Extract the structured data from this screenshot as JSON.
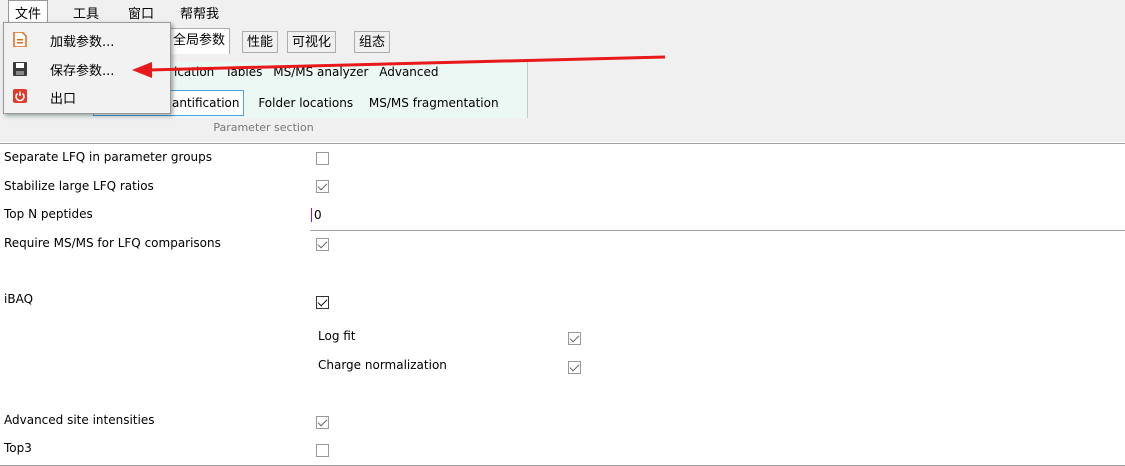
{
  "menubar": {
    "items": [
      "文件",
      "工具",
      "窗口",
      "帮帮我"
    ]
  },
  "file_menu": {
    "items": [
      "加载参数...",
      "保存参数...",
      "出口"
    ]
  },
  "tabs": [
    "全局参数",
    "性能",
    "可视化",
    "组态"
  ],
  "ribbon": {
    "row1": [
      "ication",
      "Tables",
      "MS/MS analyzer",
      "Advanced"
    ],
    "row2": [
      "antification",
      "Folder locations",
      "MS/MS fragmentation"
    ],
    "section_label": "Parameter section"
  },
  "params": {
    "separate_lfq": {
      "label": "Separate LFQ in parameter groups",
      "checked": false
    },
    "stabilize_lfq": {
      "label": "Stabilize large LFQ ratios",
      "checked": true
    },
    "top_n": {
      "label": "Top N peptides",
      "value": "0"
    },
    "require_msms": {
      "label": "Require MS/MS for LFQ comparisons",
      "checked": true
    },
    "ibaq": {
      "label": "iBAQ",
      "checked": true
    },
    "log_fit": {
      "label": "Log fit",
      "checked": true
    },
    "charge_norm": {
      "label": "Charge normalization",
      "checked": true
    },
    "adv_site": {
      "label": "Advanced site intensities",
      "checked": true
    },
    "top3": {
      "label": "Top3",
      "checked": false
    }
  },
  "colors": {
    "arrow": "#e8191a",
    "ribbon_bg": "#ecf8f4",
    "selected_border": "#4aa3df"
  },
  "icons": [
    "file-icon",
    "save-icon",
    "exit-icon"
  ]
}
